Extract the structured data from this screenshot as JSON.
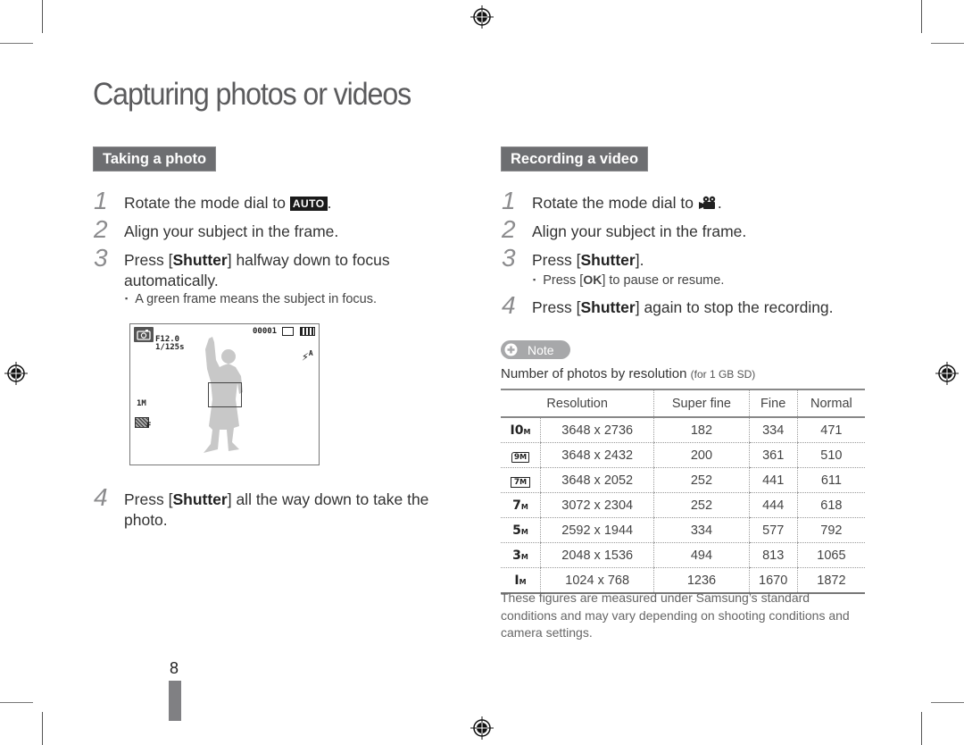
{
  "page": {
    "title": "Capturing photos or videos",
    "page_number": "8"
  },
  "taking_photo": {
    "heading": "Taking a photo",
    "steps": [
      {
        "num": "1",
        "pre": "Rotate the mode dial to ",
        "icon": "AUTO",
        "post": "."
      },
      {
        "num": "2",
        "text": "Align your subject in the frame."
      },
      {
        "num": "3",
        "pre": "Press [",
        "bold": "Shutter",
        "post": "] halfway down to focus",
        "line2": "automatically."
      },
      {
        "num": "4",
        "pre": "Press [",
        "bold": "Shutter",
        "post": "] all the way down to take the",
        "line2": "photo."
      }
    ],
    "bullet": "A green frame means the subject in focus.",
    "preview": {
      "aperture": "F12.0",
      "shutter_speed": "1/125s",
      "shot_count": "00001",
      "flash": "A",
      "resolution": "1M",
      "quality": "F"
    }
  },
  "recording_video": {
    "heading": "Recording a video",
    "steps": [
      {
        "num": "1",
        "pre": "Rotate the mode dial to ",
        "post": "."
      },
      {
        "num": "2",
        "text": "Align your subject in the frame."
      },
      {
        "num": "3",
        "pre": "Press [",
        "bold": "Shutter",
        "post": "]."
      },
      {
        "num": "4",
        "pre": "Press [",
        "bold": "Shutter",
        "post": "] again to stop the recording."
      }
    ],
    "bullet_pre": "Press [",
    "bullet_key": "OK",
    "bullet_post": "] to pause or resume."
  },
  "note": {
    "label": "Note",
    "caption": "Number of photos by resolution",
    "caption_small": "(for 1 GB SD)",
    "table": {
      "headers": [
        "Resolution",
        "Super fine",
        "Fine",
        "Normal"
      ],
      "rows": [
        {
          "icon": "10M",
          "resolution": "3648 x 2736",
          "super_fine": "182",
          "fine": "334",
          "normal": "471"
        },
        {
          "icon": "9M (3:2)",
          "resolution": "3648 x 2432",
          "super_fine": "200",
          "fine": "361",
          "normal": "510"
        },
        {
          "icon": "7M (16:9)",
          "resolution": "3648 x 2052",
          "super_fine": "252",
          "fine": "441",
          "normal": "611"
        },
        {
          "icon": "7M",
          "resolution": "3072 x 2304",
          "super_fine": "252",
          "fine": "444",
          "normal": "618"
        },
        {
          "icon": "5M",
          "resolution": "2592 x 1944",
          "super_fine": "334",
          "fine": "577",
          "normal": "792"
        },
        {
          "icon": "3M",
          "resolution": "2048 x 1536",
          "super_fine": "494",
          "fine": "813",
          "normal": "1065"
        },
        {
          "icon": "1M",
          "resolution": "1024 x 768",
          "super_fine": "1236",
          "fine": "1670",
          "normal": "1872"
        }
      ]
    },
    "footnote": "These figures are measured under Samsung’s standard conditions and may vary depending on shooting conditions and camera settings."
  }
}
